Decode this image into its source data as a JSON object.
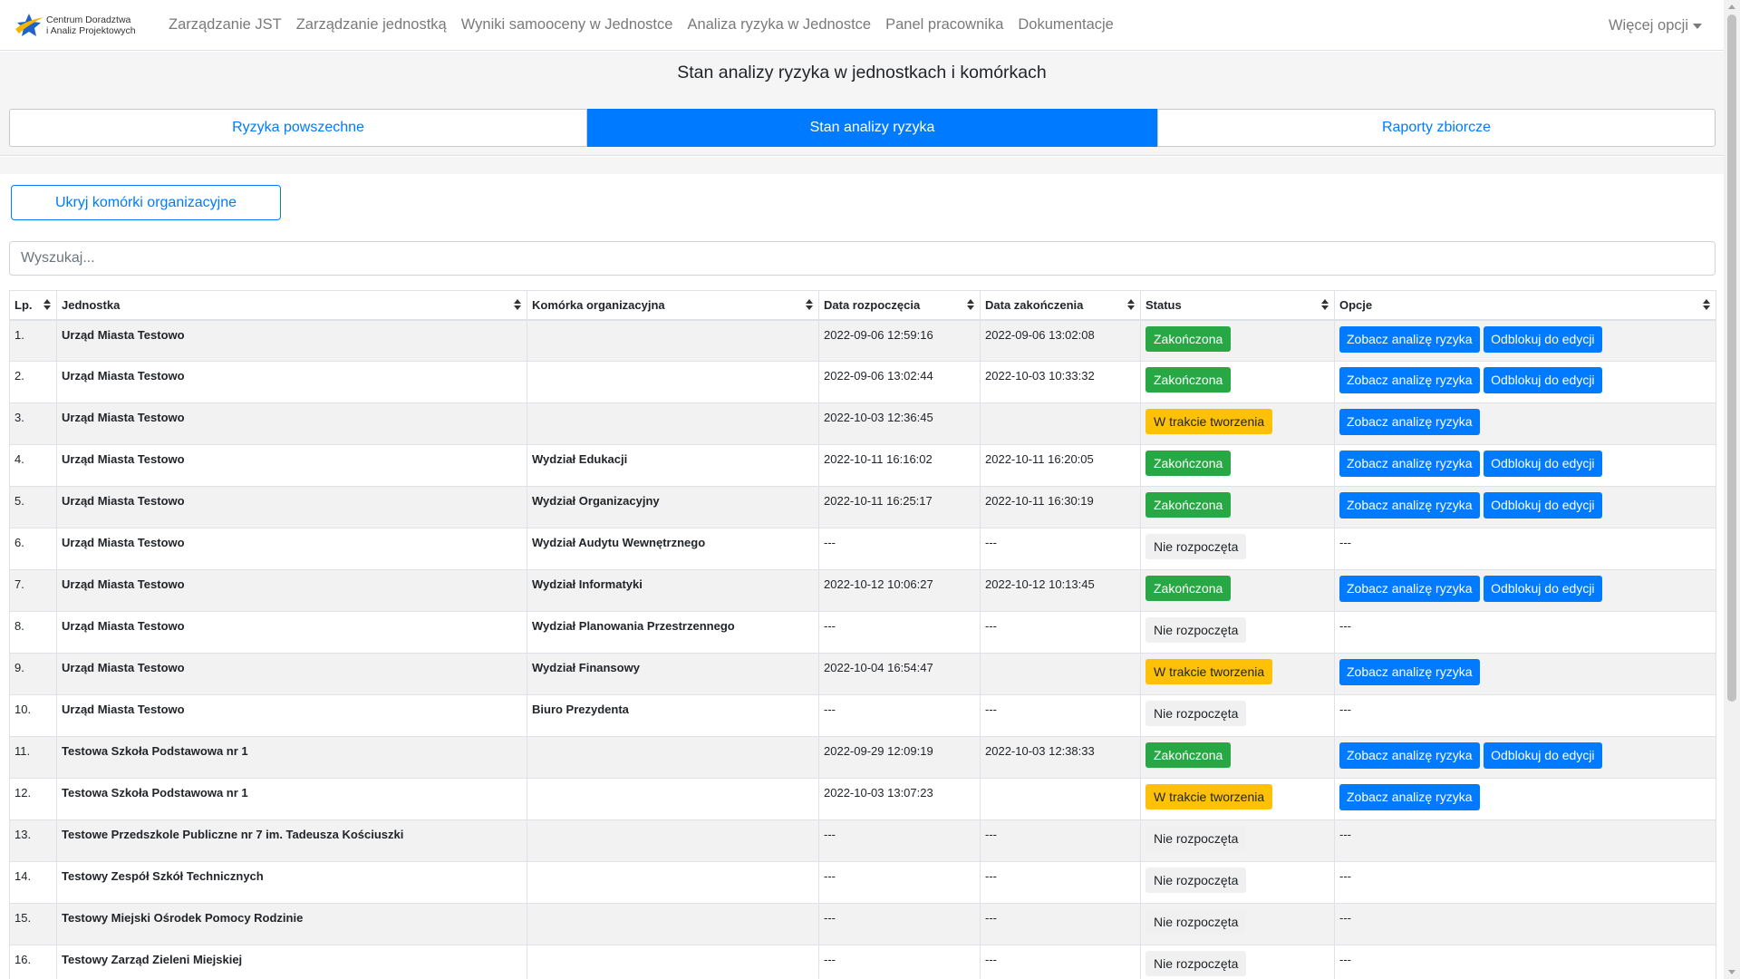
{
  "brand": {
    "line1": "Centrum Doradztwa",
    "line2": "i Analiz Projektowych",
    "accent": "#f7b500",
    "accent2": "#1e63c7"
  },
  "nav": {
    "items": [
      "Zarządzanie JST",
      "Zarządzanie jednostką",
      "Wyniki samooceny w Jednostce",
      "Analiza ryzyka w Jednostce",
      "Panel pracownika",
      "Dokumentacje"
    ],
    "more": "Więcej opcji"
  },
  "page": {
    "title": "Stan analizy ryzyka w jednostkach i komórkach"
  },
  "tabs": [
    {
      "label": "Ryzyka powszechne",
      "active": false
    },
    {
      "label": "Stan analizy ryzyka",
      "active": true
    },
    {
      "label": "Raporty zbiorcze",
      "active": false
    }
  ],
  "toggle_button": "Ukryj komórki organizacyjne",
  "search": {
    "placeholder": "Wyszukaj...",
    "value": ""
  },
  "table": {
    "headers": [
      "Lp.",
      "Jednostka",
      "Komórka organizacyjna",
      "Data rozpoczęcia",
      "Data zakończenia",
      "Status",
      "Opcje"
    ],
    "view_label": "Zobacz analizę ryzyka",
    "unlock_label": "Odblokuj do edycji",
    "rows": [
      {
        "lp": "1.",
        "unit": "Urząd Miasta Testowo",
        "cell": "",
        "start": "2022-09-06 12:59:16",
        "end": "2022-09-06 13:02:08",
        "status": "Zakończona",
        "kind": "done",
        "view": true,
        "unlock": true
      },
      {
        "lp": "2.",
        "unit": "Urząd Miasta Testowo",
        "cell": "",
        "start": "2022-09-06 13:02:44",
        "end": "2022-10-03 10:33:32",
        "status": "Zakończona",
        "kind": "done",
        "view": true,
        "unlock": true
      },
      {
        "lp": "3.",
        "unit": "Urząd Miasta Testowo",
        "cell": "",
        "start": "2022-10-03 12:36:45",
        "end": "",
        "status": "W trakcie tworzenia",
        "kind": "prog",
        "view": true,
        "unlock": false
      },
      {
        "lp": "4.",
        "unit": "Urząd Miasta Testowo",
        "cell": "Wydział Edukacji",
        "start": "2022-10-11 16:16:02",
        "end": "2022-10-11 16:20:05",
        "status": "Zakończona",
        "kind": "done",
        "view": true,
        "unlock": true
      },
      {
        "lp": "5.",
        "unit": "Urząd Miasta Testowo",
        "cell": "Wydział Organizacyjny",
        "start": "2022-10-11 16:25:17",
        "end": "2022-10-11 16:30:19",
        "status": "Zakończona",
        "kind": "done",
        "view": true,
        "unlock": true
      },
      {
        "lp": "6.",
        "unit": "Urząd Miasta Testowo",
        "cell": "Wydział Audytu Wewnętrznego",
        "start": "---",
        "end": "---",
        "status": "Nie rozpoczęta",
        "kind": "none",
        "view": false,
        "unlock": false,
        "options_text": "---"
      },
      {
        "lp": "7.",
        "unit": "Urząd Miasta Testowo",
        "cell": "Wydział Informatyki",
        "start": "2022-10-12 10:06:27",
        "end": "2022-10-12 10:13:45",
        "status": "Zakończona",
        "kind": "done",
        "view": true,
        "unlock": true
      },
      {
        "lp": "8.",
        "unit": "Urząd Miasta Testowo",
        "cell": "Wydział Planowania Przestrzennego",
        "start": "---",
        "end": "---",
        "status": "Nie rozpoczęta",
        "kind": "none",
        "view": false,
        "unlock": false,
        "options_text": "---"
      },
      {
        "lp": "9.",
        "unit": "Urząd Miasta Testowo",
        "cell": "Wydział Finansowy",
        "start": "2022-10-04 16:54:47",
        "end": "",
        "status": "W trakcie tworzenia",
        "kind": "prog",
        "view": true,
        "unlock": false
      },
      {
        "lp": "10.",
        "unit": "Urząd Miasta Testowo",
        "cell": "Biuro Prezydenta",
        "start": "---",
        "end": "---",
        "status": "Nie rozpoczęta",
        "kind": "none",
        "view": false,
        "unlock": false,
        "options_text": "---"
      },
      {
        "lp": "11.",
        "unit": "Testowa Szkoła Podstawowa nr 1",
        "cell": "",
        "start": "2022-09-29 12:09:19",
        "end": "2022-10-03 12:38:33",
        "status": "Zakończona",
        "kind": "done",
        "view": true,
        "unlock": true
      },
      {
        "lp": "12.",
        "unit": "Testowa Szkoła Podstawowa nr 1",
        "cell": "",
        "start": "2022-10-03 13:07:23",
        "end": "",
        "status": "W trakcie tworzenia",
        "kind": "prog",
        "view": true,
        "unlock": false
      },
      {
        "lp": "13.",
        "unit": "Testowe Przedszkole Publiczne nr 7 im. Tadeusza Kościuszki",
        "cell": "",
        "start": "---",
        "end": "---",
        "status": "Nie rozpoczęta",
        "kind": "none",
        "view": false,
        "unlock": false,
        "options_text": "---"
      },
      {
        "lp": "14.",
        "unit": "Testowy Zespół Szkół Technicznych",
        "cell": "",
        "start": "---",
        "end": "---",
        "status": "Nie rozpoczęta",
        "kind": "none",
        "view": false,
        "unlock": false,
        "options_text": "---"
      },
      {
        "lp": "15.",
        "unit": "Testowy Miejski Ośrodek Pomocy Rodzinie",
        "cell": "",
        "start": "---",
        "end": "---",
        "status": "Nie rozpoczęta",
        "kind": "none",
        "view": false,
        "unlock": false,
        "options_text": "---"
      },
      {
        "lp": "16.",
        "unit": "Testowy Zarząd Zieleni Miejskiej",
        "cell": "",
        "start": "---",
        "end": "---",
        "status": "Nie rozpoczęta",
        "kind": "none",
        "view": false,
        "unlock": false,
        "options_text": "---"
      }
    ]
  }
}
